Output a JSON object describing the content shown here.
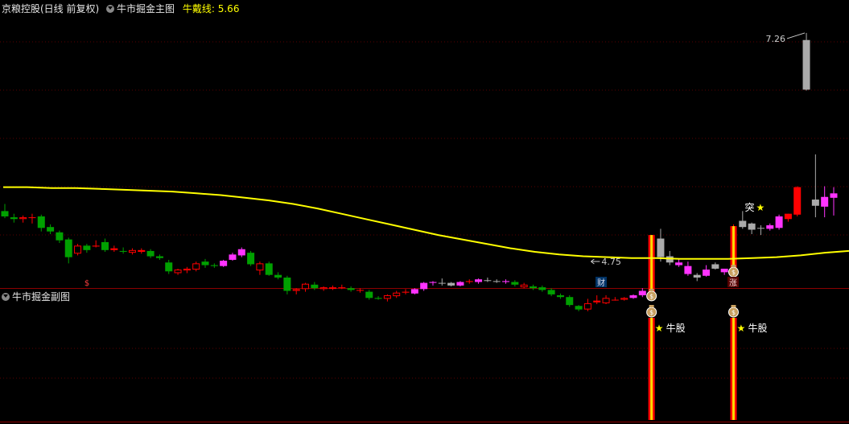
{
  "header": {
    "stock_label": "京粮控股(日线 前复权)",
    "main_indicator": "牛市掘金主图",
    "ma_label": "牛戴线:",
    "ma_value": "5.66",
    "sub_indicator": "牛市掘金副图"
  },
  "colors": {
    "background": "#000000",
    "divider": "#8b0000",
    "grid": "#5a0000",
    "ma_line": "#ffff00",
    "bull_solid": "#ff0000",
    "bull_hollow": "#ff0000",
    "bear": "#00a000",
    "magenta": "#ff33ff",
    "gray": "#aaaaaa",
    "signal_red": "#ff0000",
    "signal_yellow": "#ffd700"
  },
  "chart_data": {
    "type": "candlestick",
    "price_range": [
      4.4,
      7.45
    ],
    "candles": [
      {
        "o": 5.25,
        "h": 5.33,
        "l": 5.17,
        "c": 5.19,
        "t": "bear"
      },
      {
        "o": 5.18,
        "h": 5.22,
        "l": 5.12,
        "c": 5.16,
        "t": "bear"
      },
      {
        "o": 5.16,
        "h": 5.2,
        "l": 5.12,
        "c": 5.18,
        "t": "hollow"
      },
      {
        "o": 5.18,
        "h": 5.22,
        "l": 5.11,
        "c": 5.18,
        "t": "bull"
      },
      {
        "o": 5.19,
        "h": 5.21,
        "l": 5.02,
        "c": 5.06,
        "t": "bear"
      },
      {
        "o": 5.07,
        "h": 5.1,
        "l": 4.99,
        "c": 5.02,
        "t": "bear"
      },
      {
        "o": 5.01,
        "h": 5.03,
        "l": 4.89,
        "c": 4.92,
        "t": "bear"
      },
      {
        "o": 4.93,
        "h": 4.95,
        "l": 4.66,
        "c": 4.73,
        "t": "bear"
      },
      {
        "o": 4.77,
        "h": 4.88,
        "l": 4.75,
        "c": 4.86,
        "t": "hollow"
      },
      {
        "o": 4.86,
        "h": 4.88,
        "l": 4.78,
        "c": 4.81,
        "t": "bear"
      },
      {
        "o": 4.85,
        "h": 4.92,
        "l": 4.84,
        "c": 4.86,
        "t": "bull"
      },
      {
        "o": 4.9,
        "h": 4.94,
        "l": 4.79,
        "c": 4.81,
        "t": "bear"
      },
      {
        "o": 4.81,
        "h": 4.86,
        "l": 4.79,
        "c": 4.83,
        "t": "bull"
      },
      {
        "o": 4.8,
        "h": 4.84,
        "l": 4.77,
        "c": 4.8,
        "t": "bear"
      },
      {
        "o": 4.78,
        "h": 4.83,
        "l": 4.76,
        "c": 4.81,
        "t": "hollow"
      },
      {
        "o": 4.79,
        "h": 4.83,
        "l": 4.77,
        "c": 4.81,
        "t": "bull"
      },
      {
        "o": 4.8,
        "h": 4.82,
        "l": 4.72,
        "c": 4.74,
        "t": "bear"
      },
      {
        "o": 4.74,
        "h": 4.76,
        "l": 4.7,
        "c": 4.72,
        "t": "bear"
      },
      {
        "o": 4.67,
        "h": 4.7,
        "l": 4.54,
        "c": 4.57,
        "t": "bear"
      },
      {
        "o": 4.55,
        "h": 4.6,
        "l": 4.53,
        "c": 4.59,
        "t": "hollow"
      },
      {
        "o": 4.58,
        "h": 4.62,
        "l": 4.55,
        "c": 4.6,
        "t": "hollow"
      },
      {
        "o": 4.59,
        "h": 4.68,
        "l": 4.57,
        "c": 4.66,
        "t": "hollow"
      },
      {
        "o": 4.68,
        "h": 4.71,
        "l": 4.61,
        "c": 4.64,
        "t": "bear"
      },
      {
        "o": 4.63,
        "h": 4.66,
        "l": 4.61,
        "c": 4.64,
        "t": "bear"
      },
      {
        "o": 4.63,
        "h": 4.7,
        "l": 4.62,
        "c": 4.69,
        "t": "magenta"
      },
      {
        "o": 4.7,
        "h": 4.78,
        "l": 4.69,
        "c": 4.76,
        "t": "magenta"
      },
      {
        "o": 4.75,
        "h": 4.84,
        "l": 4.73,
        "c": 4.82,
        "t": "magenta"
      },
      {
        "o": 4.78,
        "h": 4.8,
        "l": 4.63,
        "c": 4.65,
        "t": "bear"
      },
      {
        "o": 4.66,
        "h": 4.68,
        "l": 4.53,
        "c": 4.58,
        "t": "hollow"
      },
      {
        "o": 4.66,
        "h": 4.68,
        "l": 4.52,
        "c": 4.53,
        "t": "bear"
      },
      {
        "o": 4.53,
        "h": 4.56,
        "l": 4.48,
        "c": 4.5,
        "t": "bear"
      },
      {
        "o": 4.5,
        "h": 4.52,
        "l": 4.31,
        "c": 4.35,
        "t": "bear"
      },
      {
        "o": 4.35,
        "h": 4.38,
        "l": 4.31,
        "c": 4.37,
        "t": "hollow"
      },
      {
        "o": 4.37,
        "h": 4.44,
        "l": 4.34,
        "c": 4.43,
        "t": "hollow"
      },
      {
        "o": 4.42,
        "h": 4.45,
        "l": 4.36,
        "c": 4.38,
        "t": "bear"
      },
      {
        "o": 4.37,
        "h": 4.4,
        "l": 4.35,
        "c": 4.39,
        "t": "hollow"
      },
      {
        "o": 4.38,
        "h": 4.41,
        "l": 4.36,
        "c": 4.39,
        "t": "hollow"
      },
      {
        "o": 4.39,
        "h": 4.42,
        "l": 4.37,
        "c": 4.39,
        "t": "bull"
      },
      {
        "o": 4.38,
        "h": 4.4,
        "l": 4.34,
        "c": 4.36,
        "t": "bear"
      },
      {
        "o": 4.36,
        "h": 4.38,
        "l": 4.33,
        "c": 4.36,
        "t": "bull"
      },
      {
        "o": 4.34,
        "h": 4.36,
        "l": 4.25,
        "c": 4.27,
        "t": "bear"
      },
      {
        "o": 4.26,
        "h": 4.29,
        "l": 4.25,
        "c": 4.27,
        "t": "bear"
      },
      {
        "o": 4.26,
        "h": 4.31,
        "l": 4.23,
        "c": 4.3,
        "t": "hollow"
      },
      {
        "o": 4.29,
        "h": 4.35,
        "l": 4.27,
        "c": 4.33,
        "t": "hollow"
      },
      {
        "o": 4.33,
        "h": 4.37,
        "l": 4.31,
        "c": 4.34,
        "t": "bull"
      },
      {
        "o": 4.32,
        "h": 4.38,
        "l": 4.31,
        "c": 4.37,
        "t": "magenta"
      },
      {
        "o": 4.37,
        "h": 4.45,
        "l": 4.35,
        "c": 4.44,
        "t": "magenta"
      },
      {
        "o": 4.44,
        "h": 4.46,
        "l": 4.41,
        "c": 4.45,
        "t": "magenta"
      },
      {
        "o": 4.44,
        "h": 4.49,
        "l": 4.41,
        "c": 4.44,
        "t": "gray"
      },
      {
        "o": 4.44,
        "h": 4.45,
        "l": 4.4,
        "c": 4.41,
        "t": "gray"
      },
      {
        "o": 4.41,
        "h": 4.46,
        "l": 4.4,
        "c": 4.45,
        "t": "magenta"
      },
      {
        "o": 4.45,
        "h": 4.48,
        "l": 4.43,
        "c": 4.46,
        "t": "bull"
      },
      {
        "o": 4.45,
        "h": 4.49,
        "l": 4.43,
        "c": 4.48,
        "t": "magenta"
      },
      {
        "o": 4.47,
        "h": 4.5,
        "l": 4.45,
        "c": 4.47,
        "t": "gray"
      },
      {
        "o": 4.46,
        "h": 4.48,
        "l": 4.44,
        "c": 4.46,
        "t": "gray"
      },
      {
        "o": 4.46,
        "h": 4.48,
        "l": 4.43,
        "c": 4.45,
        "t": "magenta"
      },
      {
        "o": 4.45,
        "h": 4.47,
        "l": 4.4,
        "c": 4.42,
        "t": "bear"
      },
      {
        "o": 4.42,
        "h": 4.44,
        "l": 4.38,
        "c": 4.39,
        "t": "hollow"
      },
      {
        "o": 4.4,
        "h": 4.42,
        "l": 4.36,
        "c": 4.38,
        "t": "bear"
      },
      {
        "o": 4.39,
        "h": 4.41,
        "l": 4.34,
        "c": 4.36,
        "t": "bear"
      },
      {
        "o": 4.36,
        "h": 4.38,
        "l": 4.29,
        "c": 4.31,
        "t": "bear"
      },
      {
        "o": 4.3,
        "h": 4.32,
        "l": 4.26,
        "c": 4.28,
        "t": "bear"
      },
      {
        "o": 4.28,
        "h": 4.3,
        "l": 4.17,
        "c": 4.19,
        "t": "bear"
      },
      {
        "o": 4.18,
        "h": 4.19,
        "l": 4.12,
        "c": 4.14,
        "t": "bear"
      },
      {
        "o": 4.14,
        "h": 4.26,
        "l": 4.12,
        "c": 4.21,
        "t": "hollow"
      },
      {
        "o": 4.22,
        "h": 4.3,
        "l": 4.2,
        "c": 4.24,
        "t": "bull"
      },
      {
        "o": 4.21,
        "h": 4.3,
        "l": 4.2,
        "c": 4.27,
        "t": "hollow"
      },
      {
        "o": 4.25,
        "h": 4.28,
        "l": 4.24,
        "c": 4.25,
        "t": "bull"
      },
      {
        "o": 4.25,
        "h": 4.28,
        "l": 4.24,
        "c": 4.27,
        "t": "hollow"
      },
      {
        "o": 4.27,
        "h": 4.31,
        "l": 4.26,
        "c": 4.3,
        "t": "magenta"
      },
      {
        "o": 4.3,
        "h": 4.38,
        "l": 4.28,
        "c": 4.35,
        "t": "magenta"
      },
      {
        "o": 4.32,
        "h": 4.98,
        "l": 4.31,
        "c": 4.98,
        "t": "signal"
      },
      {
        "o": 4.94,
        "h": 5.05,
        "l": 4.68,
        "c": 4.73,
        "t": "gray"
      },
      {
        "o": 4.74,
        "h": 4.8,
        "l": 4.64,
        "c": 4.67,
        "t": "gray"
      },
      {
        "o": 4.67,
        "h": 4.71,
        "l": 4.62,
        "c": 4.64,
        "t": "magenta"
      },
      {
        "o": 4.63,
        "h": 4.68,
        "l": 4.52,
        "c": 4.54,
        "t": "magenta"
      },
      {
        "o": 4.53,
        "h": 4.55,
        "l": 4.46,
        "c": 4.5,
        "t": "gray"
      },
      {
        "o": 4.52,
        "h": 4.64,
        "l": 4.51,
        "c": 4.59,
        "t": "magenta"
      },
      {
        "o": 4.6,
        "h": 4.67,
        "l": 4.59,
        "c": 4.65,
        "t": "gray"
      },
      {
        "o": 4.56,
        "h": 4.6,
        "l": 4.53,
        "c": 4.6,
        "t": "magenta"
      },
      {
        "o": 4.6,
        "h": 5.1,
        "l": 4.58,
        "c": 5.08,
        "t": "signal"
      },
      {
        "o": 5.07,
        "h": 5.25,
        "l": 5.05,
        "c": 5.14,
        "t": "gray"
      },
      {
        "o": 5.11,
        "h": 5.12,
        "l": 4.99,
        "c": 5.04,
        "t": "gray"
      },
      {
        "o": 5.06,
        "h": 5.09,
        "l": 4.98,
        "c": 5.06,
        "t": "gray"
      },
      {
        "o": 5.05,
        "h": 5.11,
        "l": 5.03,
        "c": 5.09,
        "t": "magenta"
      },
      {
        "o": 5.06,
        "h": 5.21,
        "l": 5.04,
        "c": 5.19,
        "t": "magenta"
      },
      {
        "o": 5.16,
        "h": 5.22,
        "l": 5.13,
        "c": 5.22,
        "t": "bull"
      },
      {
        "o": 5.21,
        "h": 5.53,
        "l": 5.19,
        "c": 5.52,
        "t": "bull"
      },
      {
        "o": 6.62,
        "h": 7.26,
        "l": 6.61,
        "c": 7.18,
        "t": "gray"
      },
      {
        "o": 5.38,
        "h": 5.89,
        "l": 5.18,
        "c": 5.31,
        "t": "gray"
      },
      {
        "o": 5.3,
        "h": 5.53,
        "l": 5.18,
        "c": 5.41,
        "t": "magenta"
      },
      {
        "o": 5.4,
        "h": 5.52,
        "l": 5.2,
        "c": 5.45,
        "t": "magenta"
      }
    ],
    "ma_line": [
      5.52,
      5.52,
      5.51,
      5.51,
      5.5,
      5.49,
      5.48,
      5.47,
      5.45,
      5.43,
      5.4,
      5.37,
      5.33,
      5.28,
      5.22,
      5.16,
      5.1,
      5.04,
      4.98,
      4.93,
      4.88,
      4.83,
      4.79,
      4.76,
      4.74,
      4.73,
      4.72,
      4.72,
      4.71,
      4.71,
      4.71,
      4.72,
      4.73,
      4.75,
      4.78,
      4.8
    ],
    "annotations": {
      "high_label": "7.26",
      "low_label": "4.75",
      "breakthrough_label": "突",
      "sub_signal_label": "牛股"
    },
    "markers": {
      "dollar": "$",
      "cai": "财",
      "zhang": "涨"
    }
  }
}
